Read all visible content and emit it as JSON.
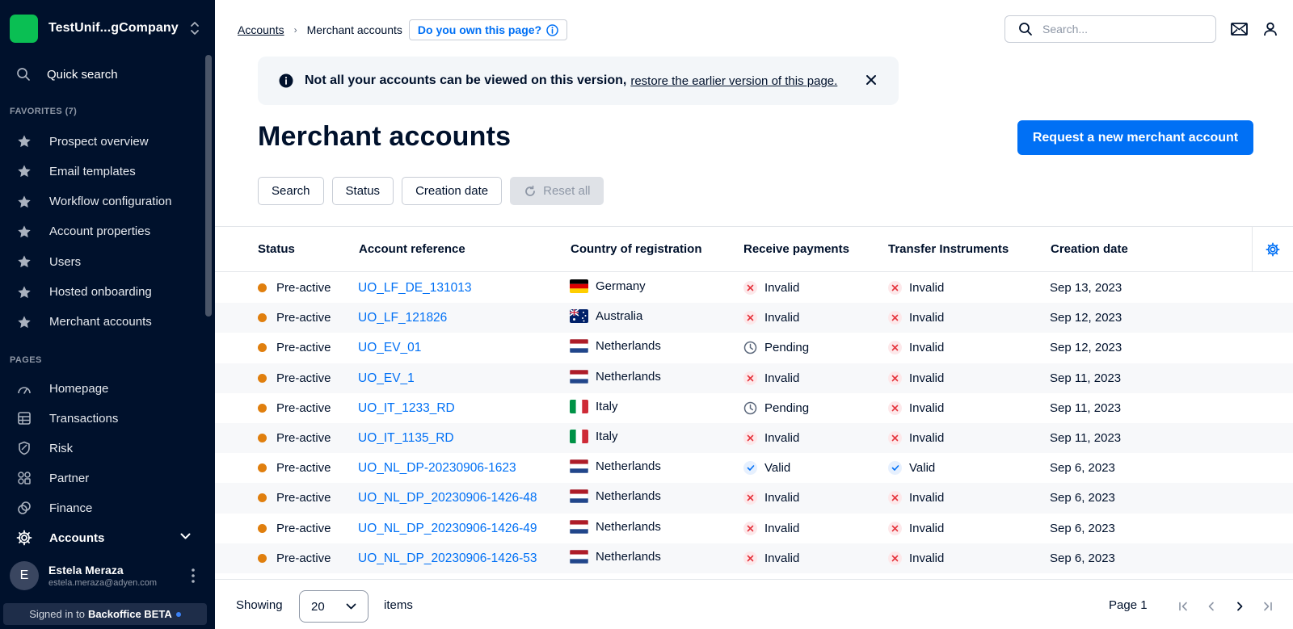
{
  "sidebar": {
    "company": "TestUnif...gCompany",
    "quick_search": "Quick search",
    "favorites_label": "FAVORITES (7)",
    "favorites": [
      {
        "label": "Prospect overview"
      },
      {
        "label": "Email templates"
      },
      {
        "label": "Workflow configuration"
      },
      {
        "label": "Account properties"
      },
      {
        "label": "Users"
      },
      {
        "label": "Hosted onboarding"
      },
      {
        "label": "Merchant accounts"
      }
    ],
    "pages_label": "PAGES",
    "pages": [
      {
        "label": "Homepage",
        "icon": "homepage-icon"
      },
      {
        "label": "Transactions",
        "icon": "transactions-icon"
      },
      {
        "label": "Risk",
        "icon": "shield-icon"
      },
      {
        "label": "Partner",
        "icon": "partner-icon"
      },
      {
        "label": "Finance",
        "icon": "finance-icon"
      },
      {
        "label": "Accounts",
        "icon": "gear-icon",
        "active": true
      }
    ],
    "user": {
      "initial": "E",
      "name": "Estela Meraza",
      "email": "estela.meraza@adyen.com"
    },
    "signed_in_prefix": "Signed in to",
    "signed_in_product": "Backoffice BETA"
  },
  "header": {
    "breadcrumb_parent": "Accounts",
    "breadcrumb_current": "Merchant accounts",
    "own_page": "Do you own this page?",
    "search_placeholder": "Search..."
  },
  "banner": {
    "message": "Not all your accounts can be viewed on this version,",
    "link": "restore the earlier version of this page."
  },
  "page": {
    "title": "Merchant accounts",
    "primary_action": "Request a new merchant account"
  },
  "filters": {
    "search": "Search",
    "status": "Status",
    "creation_date": "Creation date",
    "reset": "Reset all"
  },
  "table": {
    "columns": [
      "Status",
      "Account reference",
      "Country of registration",
      "Receive payments",
      "Transfer Instruments",
      "Creation date"
    ],
    "rows": [
      {
        "status": "Pre-active",
        "ref": "UO_LF_DE_131013",
        "country": "Germany",
        "flag": "de",
        "receive": "Invalid",
        "transfer": "Invalid",
        "date": "Sep 13, 2023"
      },
      {
        "status": "Pre-active",
        "ref": "UO_LF_121826",
        "country": "Australia",
        "flag": "au",
        "receive": "Invalid",
        "transfer": "Invalid",
        "date": "Sep 12, 2023"
      },
      {
        "status": "Pre-active",
        "ref": "UO_EV_01",
        "country": "Netherlands",
        "flag": "nl",
        "receive": "Pending",
        "transfer": "Invalid",
        "date": "Sep 12, 2023"
      },
      {
        "status": "Pre-active",
        "ref": "UO_EV_1",
        "country": "Netherlands",
        "flag": "nl",
        "receive": "Invalid",
        "transfer": "Invalid",
        "date": "Sep 11, 2023"
      },
      {
        "status": "Pre-active",
        "ref": "UO_IT_1233_RD",
        "country": "Italy",
        "flag": "it",
        "receive": "Pending",
        "transfer": "Invalid",
        "date": "Sep 11, 2023"
      },
      {
        "status": "Pre-active",
        "ref": "UO_IT_1135_RD",
        "country": "Italy",
        "flag": "it",
        "receive": "Invalid",
        "transfer": "Invalid",
        "date": "Sep 11, 2023"
      },
      {
        "status": "Pre-active",
        "ref": "UO_NL_DP-20230906-1623",
        "country": "Netherlands",
        "flag": "nl",
        "receive": "Valid",
        "transfer": "Valid",
        "date": "Sep 6, 2023"
      },
      {
        "status": "Pre-active",
        "ref": "UO_NL_DP_20230906-1426-48",
        "country": "Netherlands",
        "flag": "nl",
        "receive": "Invalid",
        "transfer": "Invalid",
        "date": "Sep 6, 2023"
      },
      {
        "status": "Pre-active",
        "ref": "UO_NL_DP_20230906-1426-49",
        "country": "Netherlands",
        "flag": "nl",
        "receive": "Invalid",
        "transfer": "Invalid",
        "date": "Sep 6, 2023"
      },
      {
        "status": "Pre-active",
        "ref": "UO_NL_DP_20230906-1426-53",
        "country": "Netherlands",
        "flag": "nl",
        "receive": "Invalid",
        "transfer": "Invalid",
        "date": "Sep 6, 2023"
      }
    ]
  },
  "footer": {
    "showing": "Showing",
    "page_size": "20",
    "items": "items",
    "page": "Page 1"
  },
  "colors": {
    "sidebar_bg": "#00112c",
    "accent": "#0070f5",
    "status_preactive": "#e07f0e",
    "invalid": "#e5343d"
  }
}
